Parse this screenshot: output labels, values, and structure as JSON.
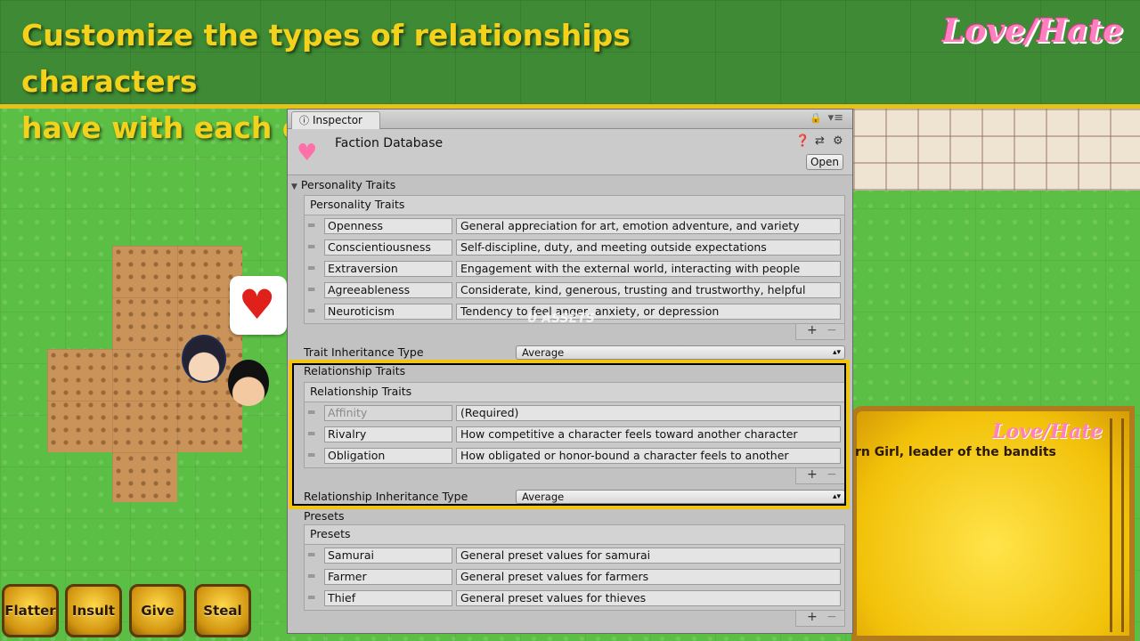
{
  "banner": {
    "headline_line1": "Customize the types of relationships characters",
    "headline_line2": "have with each other",
    "logo_text": "Love/Hate"
  },
  "game": {
    "actions": [
      "Flatter",
      "Insult",
      "Give",
      "Steal"
    ],
    "dialog_logo": "Love/Hate",
    "dialog_text": "rn Girl, leader of the bandits",
    "heart_icon": "heart-icon"
  },
  "inspector": {
    "tab_label": "Inspector",
    "asset_title": "Faction Database",
    "open_label": "Open",
    "personality": {
      "foldout_label": "Personality Traits",
      "list_header": "Personality Traits",
      "rows": [
        {
          "name": "Openness",
          "description": "General appreciation for art, emotion adventure, and variety"
        },
        {
          "name": "Conscientiousness",
          "description": "Self-discipline, duty, and meeting outside expectations"
        },
        {
          "name": "Extraversion",
          "description": "Engagement with the external world, interacting with people"
        },
        {
          "name": "Agreeableness",
          "description": "Considerate, kind, generous, trusting and trustworthy, helpful"
        },
        {
          "name": "Neuroticism",
          "description": "Tendency to feel anger, anxiety, or depression"
        }
      ],
      "inheritance_label": "Trait Inheritance Type",
      "inheritance_value": "Average"
    },
    "relationship": {
      "foldout_label": "Relationship Traits",
      "list_header": "Relationship Traits",
      "rows": [
        {
          "name": "Affinity",
          "description": "(Required)"
        },
        {
          "name": "Rivalry",
          "description": "How competitive a character feels toward another character"
        },
        {
          "name": "Obligation",
          "description": "How obligated or honor-bound a character feels to another"
        }
      ],
      "inheritance_label": "Relationship Inheritance Type",
      "inheritance_value": "Average"
    },
    "presets": {
      "foldout_label": "Presets",
      "list_header": "Presets",
      "rows": [
        {
          "name": "Samurai",
          "description": "General preset values for samurai"
        },
        {
          "name": "Farmer",
          "description": "General preset values for farmers"
        },
        {
          "name": "Thief",
          "description": "General preset values for thieves"
        }
      ]
    },
    "plus_symbol": "+",
    "minus_symbol": "−"
  },
  "watermark": "U ASSETS"
}
